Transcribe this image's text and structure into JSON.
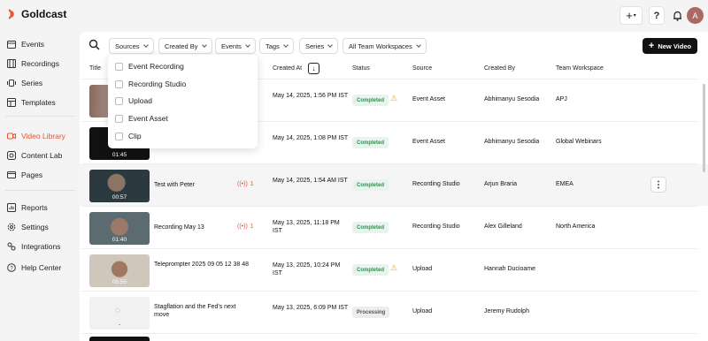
{
  "brand": {
    "name": "Goldcast",
    "accent": "#e8542f"
  },
  "topbar": {
    "add_icon": "plus-icon",
    "help_label": "?",
    "bell_icon": "bell-icon",
    "avatar_initial": "A"
  },
  "sidebar": {
    "items": [
      {
        "label": "Events",
        "icon": "calendar-icon"
      },
      {
        "label": "Recordings",
        "icon": "film-icon"
      },
      {
        "label": "Series",
        "icon": "series-icon"
      },
      {
        "label": "Templates",
        "icon": "template-icon"
      },
      {
        "label": "Video Library",
        "icon": "video-icon",
        "active": true
      },
      {
        "label": "Content Lab",
        "icon": "lab-icon"
      },
      {
        "label": "Pages",
        "icon": "pages-icon"
      },
      {
        "label": "Reports",
        "icon": "reports-icon"
      },
      {
        "label": "Settings",
        "icon": "gear-icon"
      },
      {
        "label": "Integrations",
        "icon": "integrations-icon"
      },
      {
        "label": "Help Center",
        "icon": "help-icon"
      }
    ]
  },
  "filters": {
    "sources": "Sources",
    "created_by": "Created By",
    "events": "Events",
    "tags": "Tags",
    "series": "Series",
    "workspaces": "All Team Workspaces",
    "new_video": "New Video"
  },
  "dropdown": {
    "options": [
      "Event Recording",
      "Recording Studio",
      "Upload",
      "Event Asset",
      "Clip"
    ]
  },
  "table": {
    "headers": {
      "title": "Title",
      "created_at": "Created At",
      "status": "Status",
      "source": "Source",
      "created_by": "Created By",
      "workspace": "Team Workspace"
    },
    "rows": [
      {
        "duration": "",
        "title": "",
        "live_count": "",
        "created": "May 14, 2025, 1:56 PM IST",
        "status": "Completed",
        "warning": true,
        "source": "Event Asset",
        "created_by": "Abhimanyu Sesodia",
        "workspace": "APJ"
      },
      {
        "duration": "01:45",
        "title": "",
        "live_count": "",
        "created": "May 14, 2025, 1:08 PM IST",
        "status": "Completed",
        "warning": false,
        "source": "Event Asset",
        "created_by": "Abhimanyu Sesodia",
        "workspace": "Global Webinars"
      },
      {
        "duration": "00:57",
        "title": "Test with Peter",
        "live_count": "1",
        "created": "May 14, 2025, 1:54 AM IST",
        "status": "Completed",
        "warning": false,
        "source": "Recording Studio",
        "created_by": "Arjun Braria",
        "workspace": "EMEA"
      },
      {
        "duration": "01:40",
        "title": "Recording May 13",
        "live_count": "1",
        "created": "May 13, 2025, 11:18 PM IST",
        "status": "Completed",
        "warning": false,
        "source": "Recording Studio",
        "created_by": "Alex Gilleland",
        "workspace": "North America"
      },
      {
        "duration": "05:55",
        "title": "Teleprompter 2025 09 05 12 38 48",
        "live_count": "",
        "created": "May 13, 2025, 10:24 PM IST",
        "status": "Completed",
        "warning": true,
        "source": "Upload",
        "created_by": "Hannah Ducioame",
        "workspace": ""
      },
      {
        "duration": "-",
        "title": "Stagflation and the Fed's next move",
        "live_count": "",
        "created": "May 13, 2025, 6:09 PM IST",
        "status": "Processing",
        "warning": false,
        "source": "Upload",
        "created_by": "Jeremy Rudolph",
        "workspace": ""
      }
    ]
  }
}
